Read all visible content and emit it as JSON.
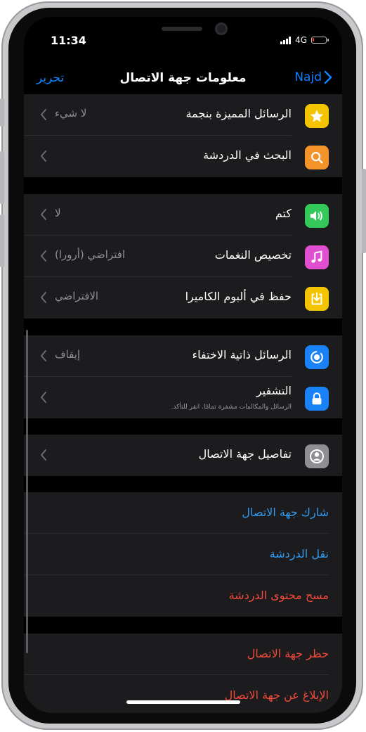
{
  "status_bar": {
    "time": "11:34",
    "network": "4G"
  },
  "nav": {
    "title": "معلومات جهة الاتصال",
    "back_label": "Najd",
    "edit_label": "تحرير"
  },
  "group1": [
    {
      "label": "الرسائل المميزة بنجمة",
      "value": "لا شيء",
      "icon": "star-icon",
      "icon_color": "#f5c400"
    },
    {
      "label": "البحث في الدردشة",
      "value": "",
      "icon": "search-icon",
      "icon_color": "#f3932a"
    }
  ],
  "group2": [
    {
      "label": "كتم",
      "value": "لا",
      "icon": "speaker-icon",
      "icon_color": "#34c759"
    },
    {
      "label": "تخصيص النغمات",
      "value": "افتراضي (أرورا)",
      "icon": "music-note-icon",
      "icon_color": "#e04fcf"
    },
    {
      "label": "حفظ في ألبوم الكاميرا",
      "value": "الافتراضي",
      "icon": "save-download-icon",
      "icon_color": "#f5c400"
    }
  ],
  "group3": [
    {
      "label": "الرسائل ذاتية الاختفاء",
      "value": "إيقاف",
      "icon": "timer-icon",
      "icon_color": "#1a82f7"
    },
    {
      "label": "التشفير",
      "sublabel": "الرسائل والمكالمات مشفرة تمامًا. انقر للتأكد.",
      "icon": "lock-icon",
      "icon_color": "#1a82f7"
    }
  ],
  "group4": [
    {
      "label": "تفاصيل جهة الاتصال",
      "icon": "contact-icon",
      "icon_color": "#8e8e93"
    }
  ],
  "actions1": [
    {
      "label": "شارك جهة الاتصال",
      "color": "#2f9bf3"
    },
    {
      "label": "نقل الدردشة",
      "color": "#2f9bf3"
    },
    {
      "label": "مسح محتوى الدردشة",
      "color": "#f2493b"
    }
  ],
  "actions2": [
    {
      "label": "حظر جهة الاتصال",
      "color": "#f2493b"
    },
    {
      "label": "الإبلاغ عن جهة الاتصال",
      "color": "#f2493b"
    }
  ]
}
